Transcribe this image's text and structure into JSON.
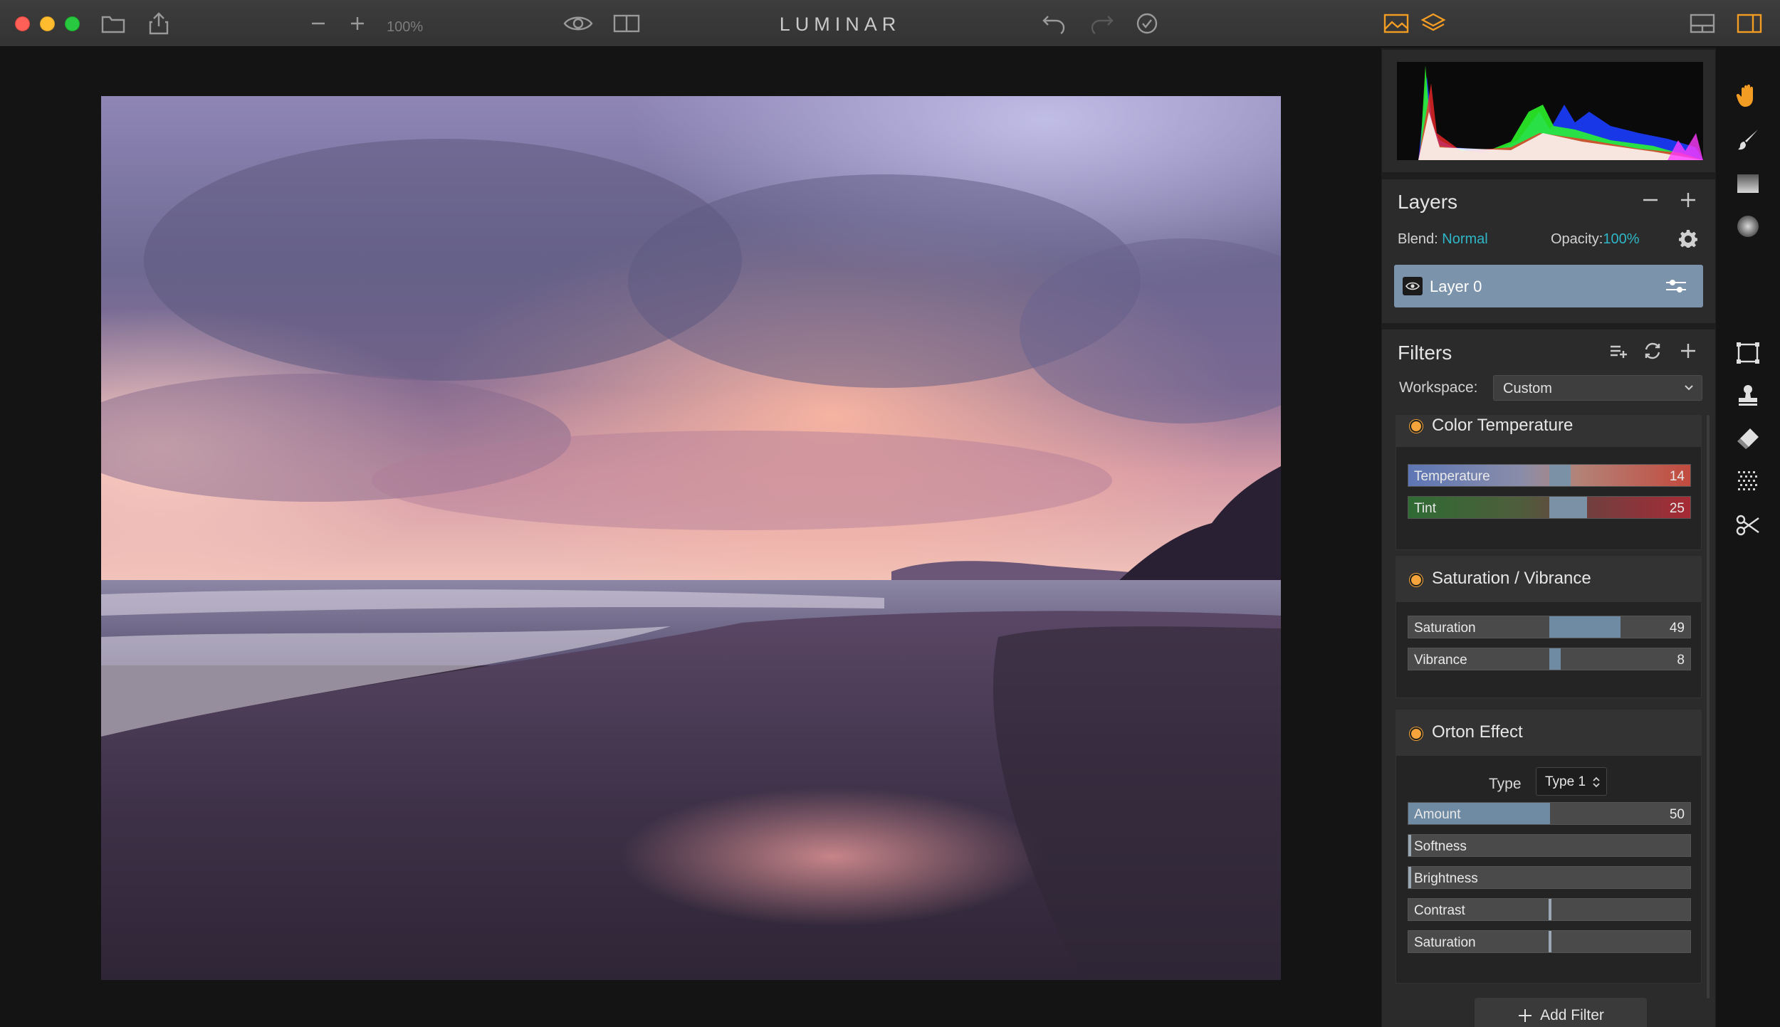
{
  "window": {
    "title": "LUMINAR",
    "zoom": "100%"
  },
  "colors": {
    "accent": "#2fb6c7",
    "filter_dot": "#f4a43a",
    "layer_selected": "#7c94ab",
    "slider_fill": "#6f8aa3",
    "active_tool": "#f39c24"
  },
  "toolbar": {
    "left_icons": [
      "folder-icon",
      "share-icon",
      "zoom-out-icon",
      "zoom-in-icon"
    ],
    "center_icons": [
      "preview-eye-icon",
      "compare-split-icon"
    ],
    "history_icons": [
      "undo-icon",
      "redo-icon",
      "history-check-icon"
    ],
    "right_icons": [
      "image-panel-icon",
      "layers-panel-icon",
      "layout-icon",
      "sidebar-toggle-icon"
    ]
  },
  "layers": {
    "title": "Layers",
    "blend_label": "Blend:",
    "blend_value": "Normal",
    "opacity_label": "Opacity:",
    "opacity_value": "100%",
    "items": [
      {
        "name": "Layer 0",
        "visible": true,
        "selected": true
      }
    ]
  },
  "filters": {
    "title": "Filters",
    "workspace_label": "Workspace:",
    "workspace_value": "Custom",
    "add_filter_label": "Add Filter",
    "color_temperature": {
      "name": "Color Temperature",
      "sliders": [
        {
          "label": "Temperature",
          "value": "14"
        },
        {
          "label": "Tint",
          "value": "25"
        }
      ]
    },
    "saturation_vibrance": {
      "name": "Saturation / Vibrance",
      "sliders": [
        {
          "label": "Saturation",
          "value": "49"
        },
        {
          "label": "Vibrance",
          "value": "8"
        }
      ]
    },
    "orton_effect": {
      "name": "Orton Effect",
      "type_label": "Type",
      "type_value": "Type 1",
      "sliders": [
        {
          "label": "Amount",
          "value": "50"
        },
        {
          "label": "Softness",
          "value": ""
        },
        {
          "label": "Brightness",
          "value": ""
        },
        {
          "label": "Contrast",
          "value": ""
        },
        {
          "label": "Saturation",
          "value": ""
        }
      ]
    }
  },
  "tools": [
    "hand-tool-icon",
    "brush-tool-icon",
    "gradient-mask-icon",
    "radial-mask-icon",
    "crop-transform-icon",
    "clone-stamp-icon",
    "eraser-icon",
    "noise-icon",
    "cut-icon"
  ]
}
